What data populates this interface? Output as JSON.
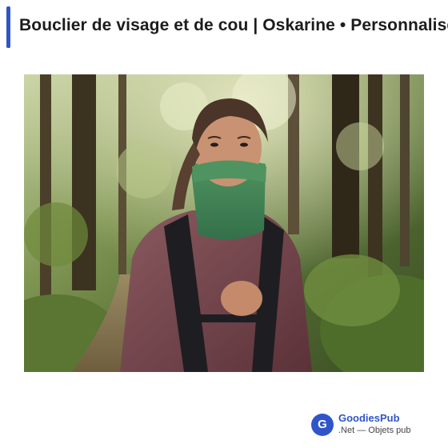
{
  "header": {
    "title": "Bouclier de visage et de cou | Oskarine • Personnalisé",
    "accent_color": "#2f55c9"
  },
  "product_image": {
    "icon": "photo-runner-neck-gaiter"
  },
  "brand": {
    "logo_letter": "G",
    "name": "GoodiesPub",
    "tagline": ".Net — Objets pub",
    "color": "#2f55c9"
  }
}
